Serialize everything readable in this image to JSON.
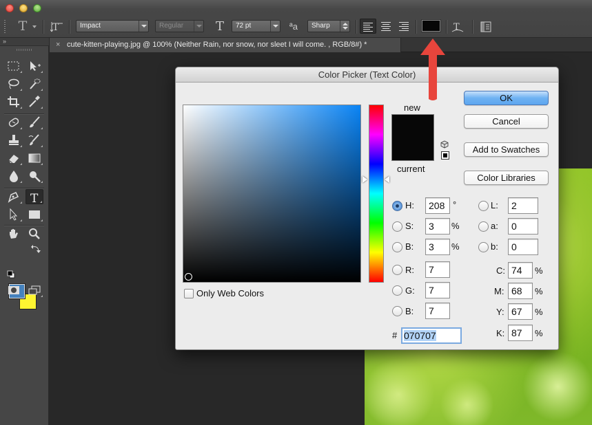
{
  "window": {
    "traffic_lights": [
      "close",
      "minimize",
      "zoom"
    ]
  },
  "options_bar": {
    "tool_glyph": "T",
    "font_family": "Impact",
    "font_style": "Regular",
    "font_size": "72 pt",
    "aa_glyph": "ªa",
    "antialias": "Sharp",
    "text_color": "#070707"
  },
  "document": {
    "tab_close": "×",
    "tab_title": "cute-kitten-playing.jpg @ 100% (Neither Rain, nor  snow, nor sleet    I will come. , RGB/8#) *"
  },
  "toolbox": {
    "collapse": "»",
    "foreground_color": "#4582be",
    "background_color": "#fef531"
  },
  "dialog": {
    "title": "Color Picker (Text Color)",
    "new_label": "new",
    "current_label": "current",
    "new_color": "#070707",
    "current_color": "#070707",
    "buttons": {
      "ok": "OK",
      "cancel": "Cancel",
      "add_to_swatches": "Add to Swatches",
      "color_libraries": "Color Libraries"
    },
    "only_web_colors": "Only Web Colors",
    "hsb": {
      "h": {
        "label": "H:",
        "value": "208",
        "unit": "°"
      },
      "s": {
        "label": "S:",
        "value": "3",
        "unit": "%"
      },
      "b": {
        "label": "B:",
        "value": "3",
        "unit": "%"
      }
    },
    "rgb": {
      "r": {
        "label": "R:",
        "value": "7"
      },
      "g": {
        "label": "G:",
        "value": "7"
      },
      "b": {
        "label": "B:",
        "value": "7"
      }
    },
    "lab": {
      "l": {
        "label": "L:",
        "value": "2"
      },
      "a": {
        "label": "a:",
        "value": "0"
      },
      "b": {
        "label": "b:",
        "value": "0"
      }
    },
    "cmyk": {
      "c": {
        "label": "C:",
        "value": "74",
        "unit": "%"
      },
      "m": {
        "label": "M:",
        "value": "68",
        "unit": "%"
      },
      "y": {
        "label": "Y:",
        "value": "67",
        "unit": "%"
      },
      "k": {
        "label": "K:",
        "value": "87",
        "unit": "%"
      }
    },
    "hex_label": "#",
    "hex_value": "070707",
    "selected_mode": "H"
  },
  "annotation": {
    "arrow_color": "#e8453c"
  }
}
